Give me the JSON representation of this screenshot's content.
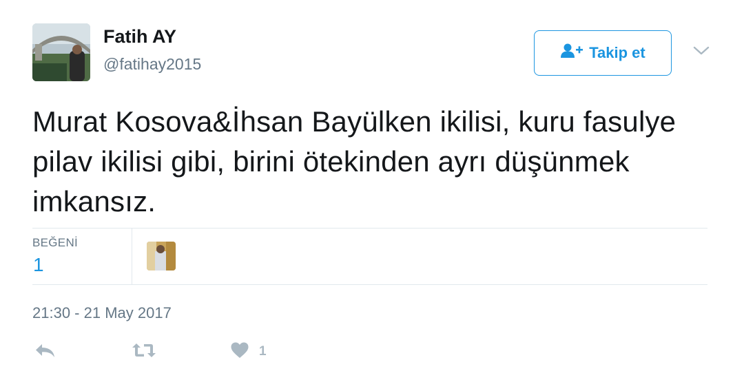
{
  "author": {
    "display_name": "Fatih AY",
    "handle": "@fatihay2015"
  },
  "follow_button": {
    "label": "Takip et",
    "icon": "add-user-icon"
  },
  "menu_icon": "chevron-down-icon",
  "tweet": {
    "text": "Murat Kosova&İhsan Bayülken ikilisi, kuru fasulye pilav ikilisi gibi, birini ötekinden ayrı düşünmek imkansız."
  },
  "stats": {
    "likes_label": "BEĞENİ",
    "likes_value": "1"
  },
  "timestamp": "21:30 - 21 May 2017",
  "actions": {
    "reply_icon": "reply-icon",
    "retweet_icon": "retweet-icon",
    "like_icon": "heart-icon",
    "like_count": "1"
  },
  "colors": {
    "accent": "#1b95e0",
    "secondary_text": "#657786",
    "action_gray": "#aab8c2",
    "divider": "#e1e8ed"
  }
}
